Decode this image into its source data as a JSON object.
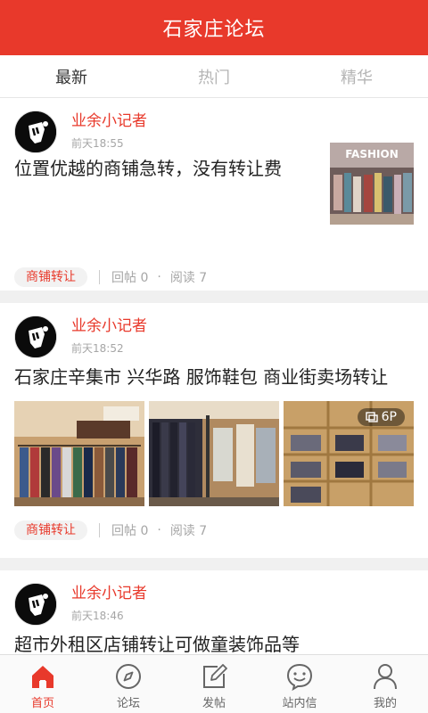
{
  "header": {
    "title": "石家庄论坛"
  },
  "tabs": [
    {
      "label": "最新",
      "active": true
    },
    {
      "label": "热门",
      "active": false
    },
    {
      "label": "精华",
      "active": false
    }
  ],
  "posts": [
    {
      "author": "业余小记者",
      "time": "前天18:55",
      "title": "位置优越的商铺急转，没有转让费",
      "thumb_text": "FASHION",
      "tag": "商铺转让",
      "replies": "回帖 0",
      "reads": "阅读 7"
    },
    {
      "author": "业余小记者",
      "time": "前天18:52",
      "title": "石家庄辛集市 兴华路 服饰鞋包 商业街卖场转让",
      "image_count": "6P",
      "tag": "商铺转让",
      "replies": "回帖 0",
      "reads": "阅读 7"
    },
    {
      "author": "业余小记者",
      "time": "前天18:46",
      "title": "超市外租区店铺转让可做童装饰品等"
    }
  ],
  "meta_dot": "·",
  "nav": [
    {
      "label": "首页",
      "icon": "home-icon",
      "active": true
    },
    {
      "label": "论坛",
      "icon": "compass-icon",
      "active": false
    },
    {
      "label": "发帖",
      "icon": "compose-icon",
      "active": false
    },
    {
      "label": "站内信",
      "icon": "message-face-icon",
      "active": false
    },
    {
      "label": "我的",
      "icon": "user-icon",
      "active": false
    }
  ],
  "colors": {
    "accent": "#e8392b",
    "muted": "#a6a6a6",
    "tag_bg": "#f2f2f2"
  }
}
